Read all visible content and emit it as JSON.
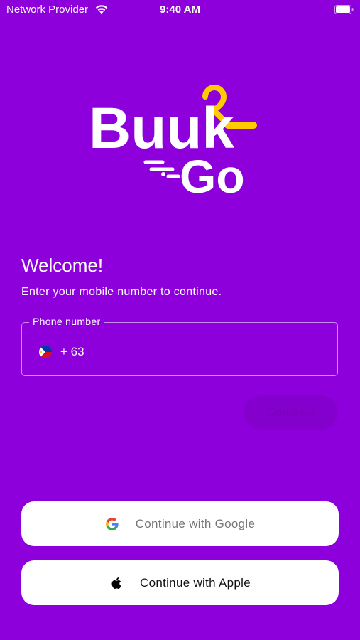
{
  "status_bar": {
    "carrier": "Network Provider",
    "time": "9:40 AM"
  },
  "logo": {
    "text_top": "Buuk",
    "text_bottom": "Go",
    "accent_color": "#ffcc00"
  },
  "welcome": {
    "title": "Welcome!",
    "subtitle": "Enter your mobile number to continue."
  },
  "phone_field": {
    "label": "Phone number",
    "country_code": "+ 63",
    "flag": "philippines-flag-icon"
  },
  "continue_button": {
    "label": "Continue"
  },
  "social": {
    "google_label": "Continue with Google",
    "apple_label": "Continue with Apple"
  },
  "colors": {
    "background": "#8d00db",
    "button_bg": "#ffffff"
  }
}
